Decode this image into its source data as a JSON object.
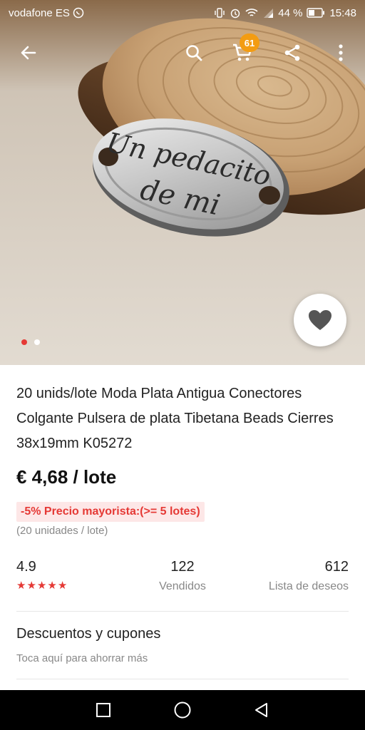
{
  "status_bar": {
    "carrier": "vodafone ES",
    "battery": "44 %",
    "time": "15:48",
    "icons": [
      "whatsapp-icon",
      "vibrate-icon",
      "alarm-icon",
      "wifi-icon",
      "signal-icon",
      "battery-icon"
    ]
  },
  "toolbar": {
    "back_icon": "arrow-left-icon",
    "search_icon": "search-icon",
    "cart_icon": "cart-icon",
    "cart_count": "61",
    "share_icon": "share-icon",
    "more_icon": "more-vertical-icon"
  },
  "gallery": {
    "image_count": 2,
    "active_index": 0,
    "wishlist_icon": "heart-icon"
  },
  "product": {
    "title": "20 unids/lote Moda Plata Antigua Conectores Colgante Pulsera de plata Tibetana Beads Cierres 38x19mm K05272",
    "price": "€ 4,68 / lote",
    "promo": "-5% Precio mayorista:(>= 5 lotes)",
    "unit_note": "(20 unidades / lote)"
  },
  "stats": {
    "rating": "4.9",
    "stars": 5,
    "sold": "122",
    "sold_label": "Vendidos",
    "wishlist": "612",
    "wishlist_label": "Lista de deseos"
  },
  "coupons": {
    "title": "Descuentos y cupones",
    "subtitle": "Toca aquí para ahorrar más"
  },
  "nav_bar": {
    "icons": [
      "recents-square-icon",
      "home-circle-icon",
      "back-triangle-icon"
    ]
  },
  "colors": {
    "accent": "#e53935",
    "badge": "#f39c12",
    "promo_bg": "#fde7e7"
  }
}
